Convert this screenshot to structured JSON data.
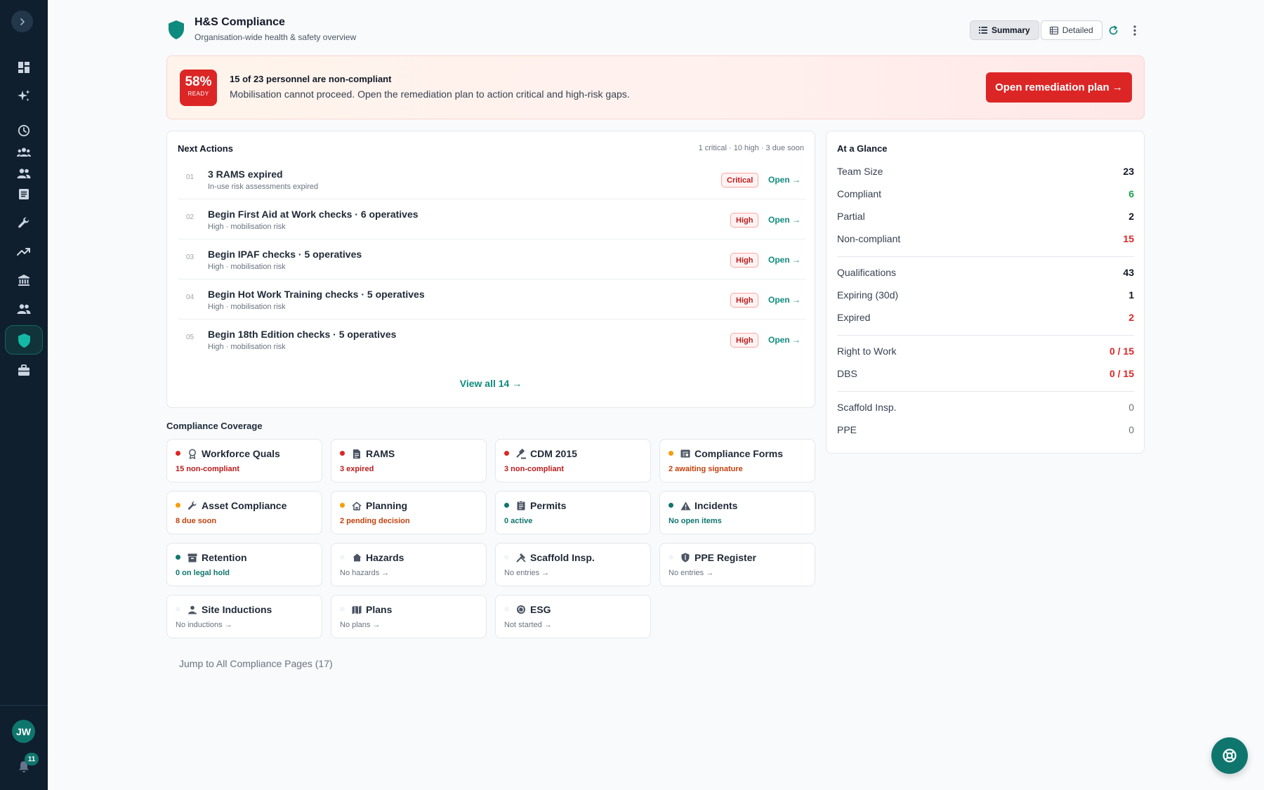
{
  "header": {
    "title": "H&S Compliance",
    "subtitle": "Organisation-wide health & safety overview",
    "summary_label": "Summary",
    "detailed_label": "Detailed"
  },
  "banner": {
    "ready_pct": "58%",
    "ready_label": "READY",
    "title": "15 of 23 personnel are non-compliant",
    "text": "Mobilisation cannot proceed. Open the remediation plan to action critical and high-risk gaps.",
    "button": "Open remediation plan →"
  },
  "next_actions": {
    "title": "Next Actions",
    "summary": "1 critical · 10 high · 3 due soon",
    "items": [
      {
        "num": "01",
        "title": "3 RAMS expired",
        "sub": "In-use risk assessments expired",
        "badge": "Critical",
        "link": "Open →"
      },
      {
        "num": "02",
        "title": "Begin First Aid at Work checks · 6 operatives",
        "sub": "High · mobilisation risk",
        "badge": "High",
        "link": "Open →"
      },
      {
        "num": "03",
        "title": "Begin IPAF checks · 5 operatives",
        "sub": "High · mobilisation risk",
        "badge": "High",
        "link": "Open →"
      },
      {
        "num": "04",
        "title": "Begin Hot Work Training checks · 5 operatives",
        "sub": "High · mobilisation risk",
        "badge": "High",
        "link": "Open →"
      },
      {
        "num": "05",
        "title": "Begin 18th Edition checks · 5 operatives",
        "sub": "High · mobilisation risk",
        "badge": "High",
        "link": "Open →"
      }
    ],
    "view_all": "View all 14 →"
  },
  "glance": {
    "title": "At a Glance",
    "rows": [
      {
        "label": "Team Size",
        "value": "23"
      },
      {
        "label": "Compliant",
        "value": "6"
      },
      {
        "label": "Partial",
        "value": "2"
      },
      {
        "label": "Non-compliant",
        "value": "15"
      },
      {
        "label": "Qualifications",
        "value": "43"
      },
      {
        "label": "Expiring (30d)",
        "value": "1"
      },
      {
        "label": "Expired",
        "value": "2"
      },
      {
        "label": "Right to Work",
        "value": "0 / 15"
      },
      {
        "label": "DBS",
        "value": "0 / 15"
      },
      {
        "label": "Scaffold Insp.",
        "value": "0"
      },
      {
        "label": "PPE",
        "value": "0"
      }
    ]
  },
  "coverage": {
    "title": "Compliance Coverage",
    "tiles": [
      {
        "name": "Workforce Quals",
        "status": "15 non-compliant",
        "icon": "award-icon"
      },
      {
        "name": "RAMS",
        "status": "3 expired",
        "icon": "document-icon"
      },
      {
        "name": "CDM 2015",
        "status": "3 non-compliant",
        "icon": "gavel-icon"
      },
      {
        "name": "Compliance Forms",
        "status": "2 awaiting signature",
        "icon": "form-icon"
      },
      {
        "name": "Asset Compliance",
        "status": "8 due soon",
        "icon": "wrench-icon"
      },
      {
        "name": "Planning",
        "status": "2 pending decision",
        "icon": "house-icon"
      },
      {
        "name": "Permits",
        "status": "0 active",
        "icon": "clipboard-icon"
      },
      {
        "name": "Incidents",
        "status": "No open items",
        "icon": "warning-icon"
      },
      {
        "name": "Retention",
        "status": "0 on legal hold",
        "icon": "archive-icon"
      },
      {
        "name": "Hazards",
        "status": "No hazards →",
        "icon": "home-icon"
      },
      {
        "name": "Scaffold Insp.",
        "status": "No entries →",
        "icon": "tools-icon"
      },
      {
        "name": "PPE Register",
        "status": "No entries →",
        "icon": "shield-icon"
      },
      {
        "name": "Site Inductions",
        "status": "No inductions →",
        "icon": "person-icon"
      },
      {
        "name": "Plans",
        "status": "No plans →",
        "icon": "map-icon"
      },
      {
        "name": "ESG",
        "status": "Not started →",
        "icon": "recycle-icon"
      }
    ],
    "jump": "Jump to All Compliance Pages (17)"
  },
  "user": {
    "initials": "JW",
    "notifications": "11"
  },
  "colors": {
    "accent": "#0f766e",
    "danger": "#dc2626",
    "warning": "#f59e0b",
    "sidebar": "#0f1f2e"
  }
}
